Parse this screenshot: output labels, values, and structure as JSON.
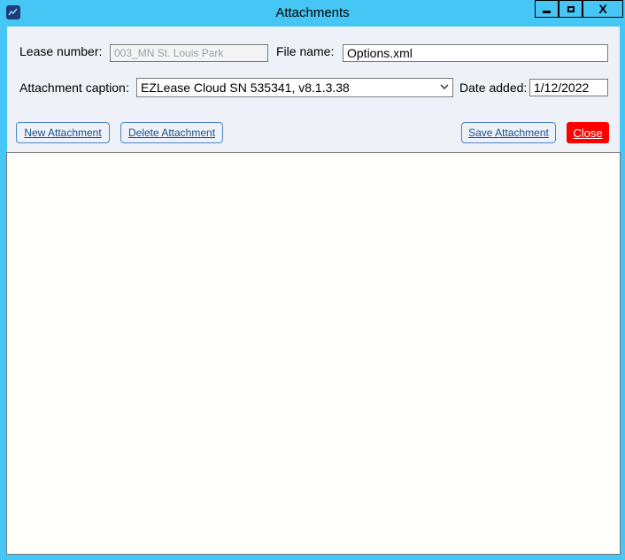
{
  "window": {
    "title": "Attachments",
    "app_icon": "app-logo-icon",
    "minimize_icon": "minimize-icon",
    "maximize_icon": "maximize-icon",
    "close_icon": "close-x-icon",
    "close_glyph": "X"
  },
  "form": {
    "lease_number_label": "Lease number:",
    "lease_number_value": "003_MN St. Louis Park",
    "file_name_label": "File name:",
    "file_name_value": "Options.xml",
    "caption_label": "Attachment caption:",
    "caption_value": "EZLease Cloud SN 535341, v8.1.3.38",
    "date_added_label": "Date added:",
    "date_added_value": "1/12/2022"
  },
  "buttons": {
    "new_attachment": "New Attachment",
    "delete_attachment": "Delete Attachment",
    "save_attachment": "Save Attachment",
    "close": "Close"
  },
  "colors": {
    "title_bar": "#45c6f5",
    "panel": "#eef2f8",
    "button_border": "#4a86c8",
    "close_button": "#ff0000",
    "content_bg": "#fffffb"
  }
}
